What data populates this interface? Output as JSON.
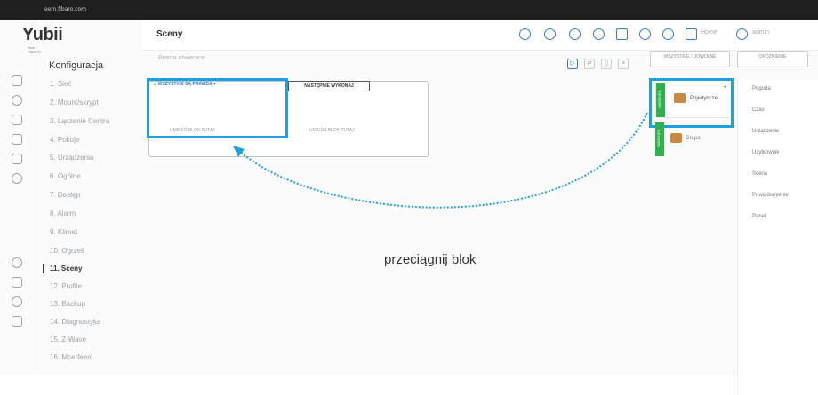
{
  "browser": {
    "tab_text": "eem.fibaro.com"
  },
  "brand": {
    "logo": "Yubii",
    "sub": "Nice / FIBARO"
  },
  "menu": {
    "title": "Konfiguracja",
    "items": [
      {
        "label": "1. Sieć"
      },
      {
        "label": "2. Mount/skrypt"
      },
      {
        "label": "3. Lączenie Centra"
      },
      {
        "label": "4. Pokoje"
      },
      {
        "label": "5. Urządzenia"
      },
      {
        "label": "6. Ogólne"
      },
      {
        "label": "7. Dostęp"
      },
      {
        "label": "8. Alarm"
      },
      {
        "label": "9. Klimat"
      },
      {
        "label": "10. Ogrzeli"
      },
      {
        "label": "11. Sceny"
      },
      {
        "label": "12. Profile"
      },
      {
        "label": "13. Backup"
      },
      {
        "label": "14. Diagnostyka"
      },
      {
        "label": "15. Z-Wave"
      },
      {
        "label": "16. Mcerfeeri"
      }
    ],
    "active_index": 10
  },
  "header": {
    "title": "Sceny",
    "home_label": "Home",
    "user_label": "admin"
  },
  "scene": {
    "name_placeholder": "Brama otwierane",
    "seg_all": "WSZYSTKIE / DOWOLNE",
    "seg_delay": "OPÓŹNIENIE",
    "condition_tag": "WSZYSTKIE SĄ PRAWDĄ",
    "then_tag": "NASTĘPNIE WYKONAJ",
    "drop_hint_left": "UMIEŚĆ BLOK TUTAJ",
    "drop_hint_right": "UMIEŚĆ BLOK TUTAJ"
  },
  "blocks": [
    {
      "tag": "WARUNEK",
      "name": "Pojedyncze",
      "plus": "+"
    },
    {
      "tag": "WARUNEK",
      "name": "Grupa"
    }
  ],
  "categories": [
    "Pogoda",
    "Czas",
    "Urządzenie",
    "Użytkownik",
    "Scena",
    "Powiadomienie",
    "Panel"
  ],
  "annotation": "przeciągnij blok",
  "colors": {
    "highlight": "#1ea0e0",
    "block_green": "#2db34a",
    "accent": "#3a7dc9"
  }
}
